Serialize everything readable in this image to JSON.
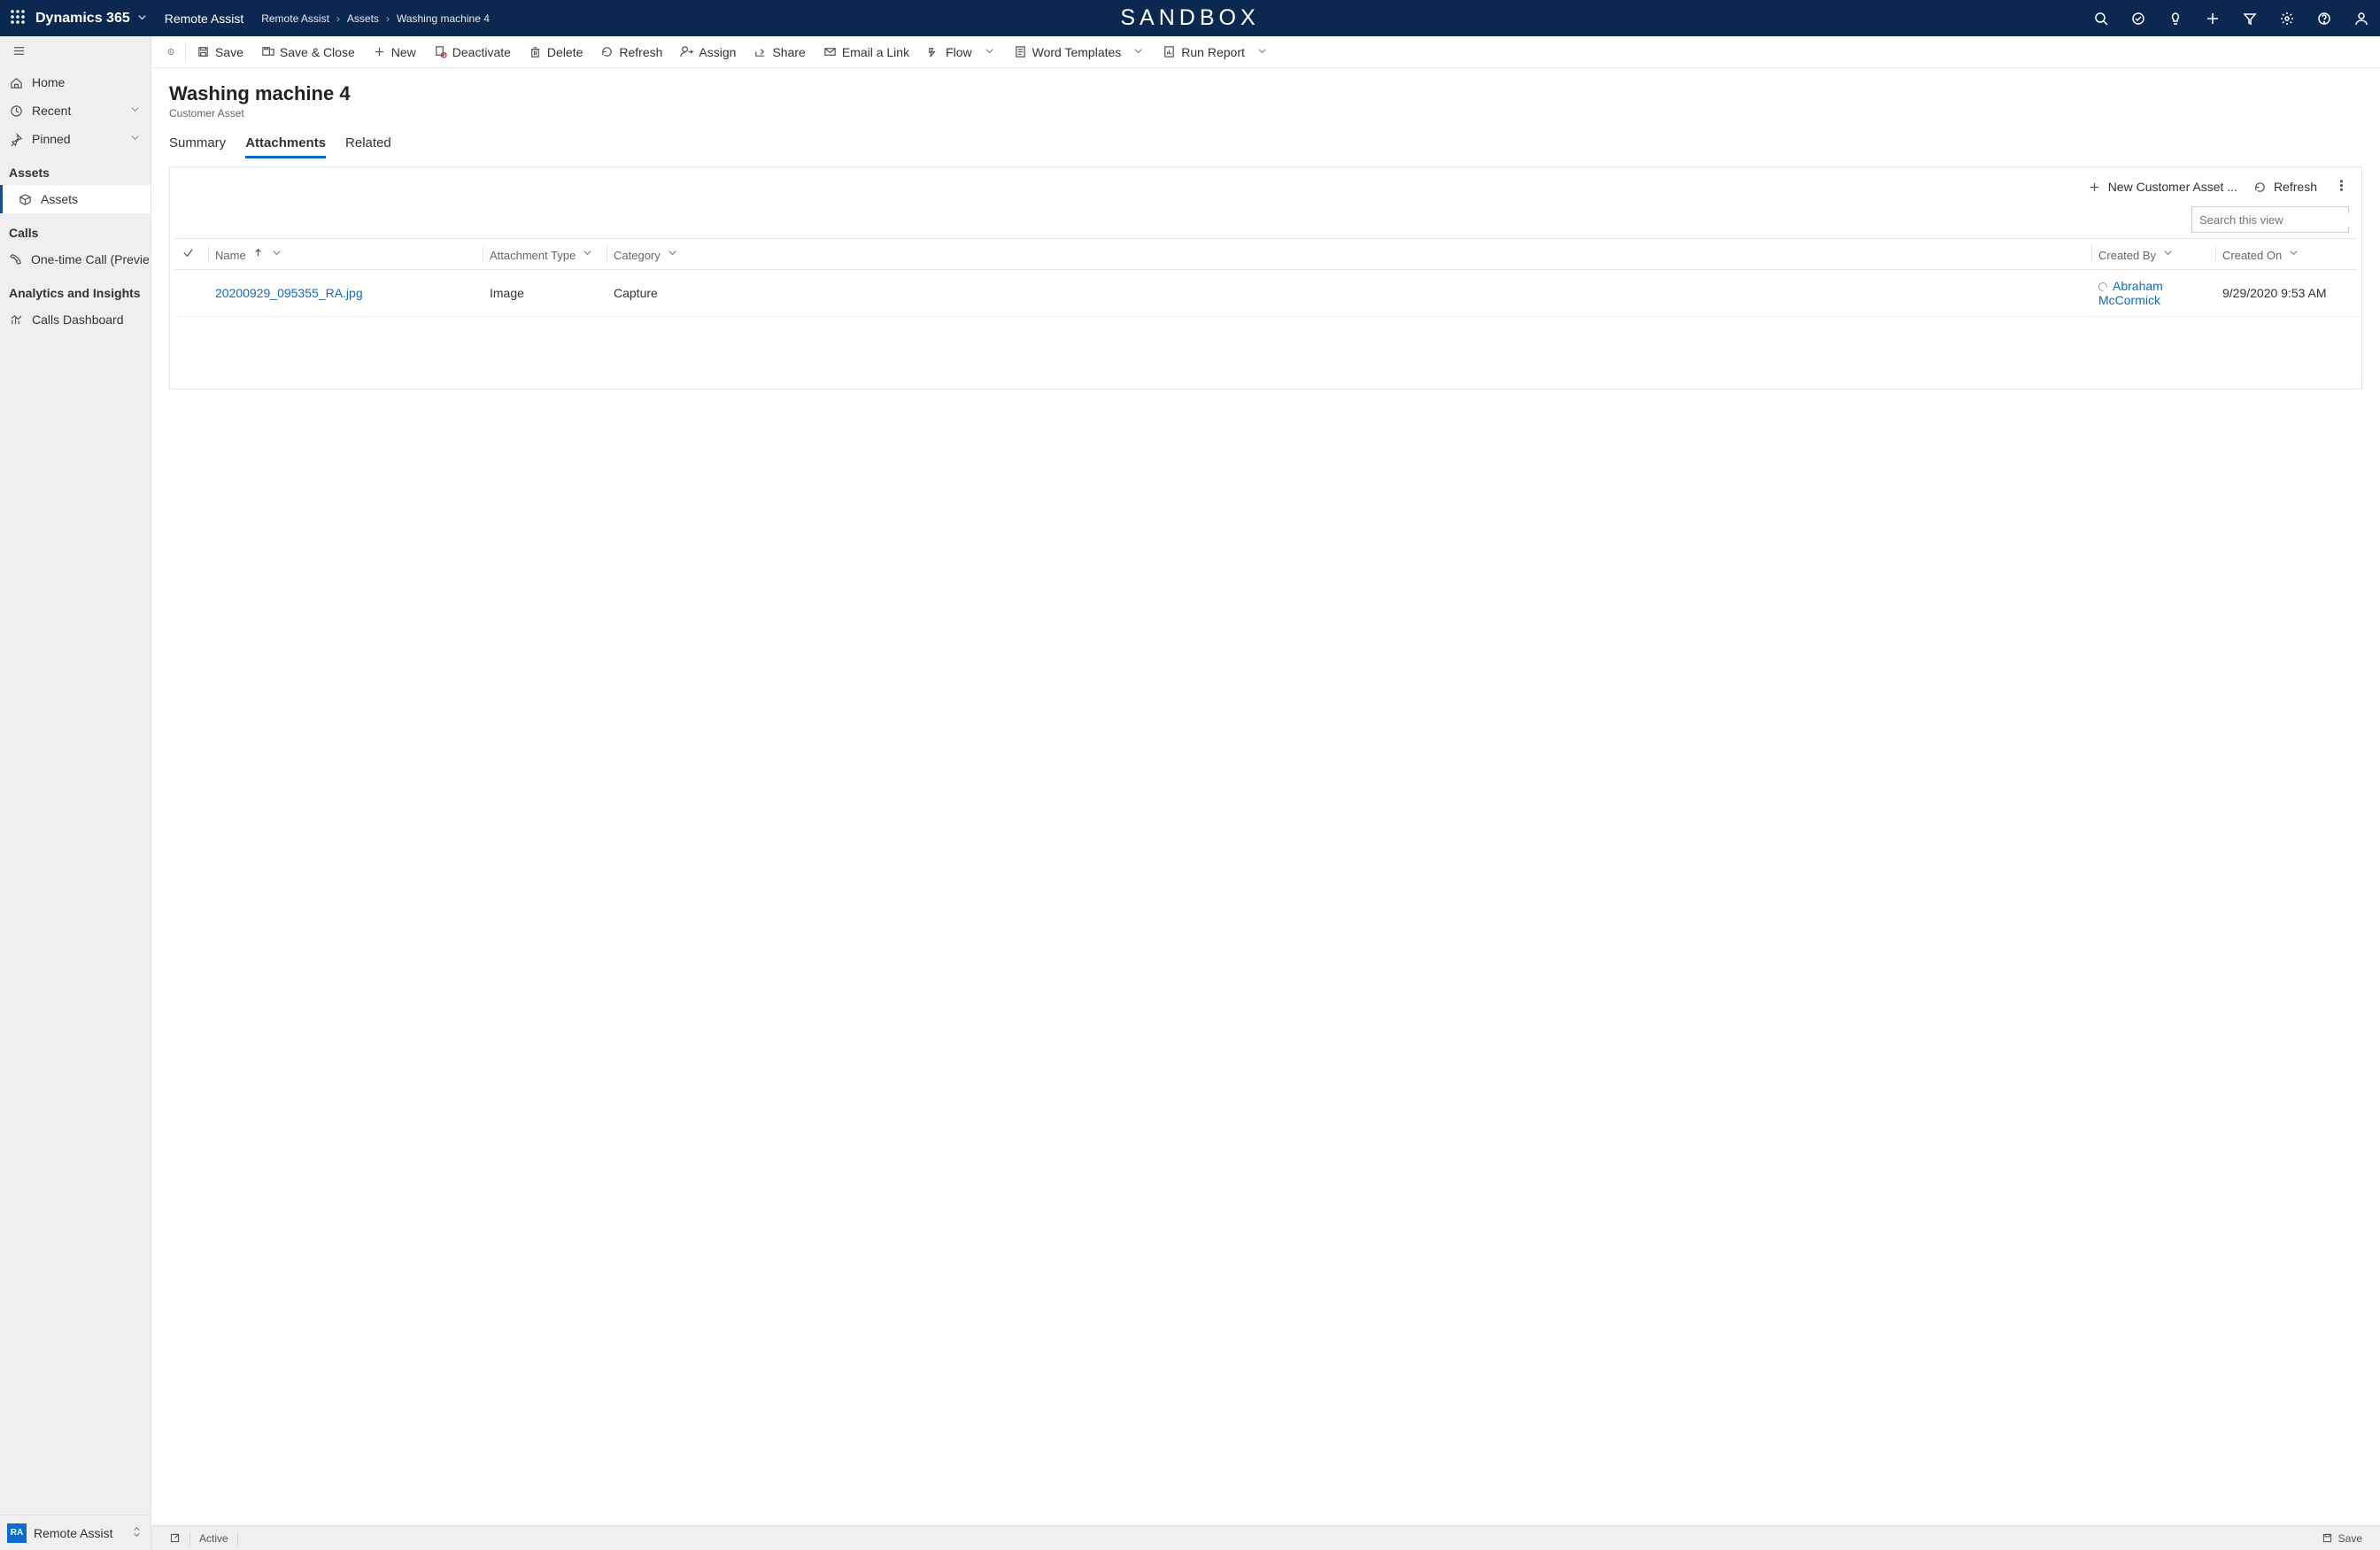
{
  "topbar": {
    "brand": "Dynamics 365",
    "app_name": "Remote Assist",
    "breadcrumb": [
      "Remote Assist",
      "Assets",
      "Washing machine 4"
    ],
    "sandbox": "SANDBOX"
  },
  "sidebar": {
    "items_top": [
      {
        "id": "home",
        "label": "Home",
        "icon": "home"
      },
      {
        "id": "recent",
        "label": "Recent",
        "icon": "clock",
        "expandable": true
      },
      {
        "id": "pinned",
        "label": "Pinned",
        "icon": "pin",
        "expandable": true
      }
    ],
    "sections": [
      {
        "title": "Assets",
        "items": [
          {
            "id": "assets",
            "label": "Assets",
            "icon": "cube",
            "selected": true
          }
        ]
      },
      {
        "title": "Calls",
        "items": [
          {
            "id": "onetime",
            "label": "One-time Call (Previe...",
            "icon": "phone"
          }
        ]
      },
      {
        "title": "Analytics and Insights",
        "items": [
          {
            "id": "dashboard",
            "label": "Calls Dashboard",
            "icon": "chart"
          }
        ]
      }
    ],
    "footer": {
      "badge": "RA",
      "label": "Remote Assist"
    }
  },
  "commands": [
    {
      "id": "back",
      "label": "",
      "icon": "back-circle"
    },
    {
      "id": "sep"
    },
    {
      "id": "save",
      "label": "Save",
      "icon": "save"
    },
    {
      "id": "saveclose",
      "label": "Save & Close",
      "icon": "saveclose"
    },
    {
      "id": "new",
      "label": "New",
      "icon": "plus",
      "accent": "green"
    },
    {
      "id": "deactivate",
      "label": "Deactivate",
      "icon": "deactivate",
      "accent": "red"
    },
    {
      "id": "delete",
      "label": "Delete",
      "icon": "trash"
    },
    {
      "id": "refresh",
      "label": "Refresh",
      "icon": "refresh"
    },
    {
      "id": "assign",
      "label": "Assign",
      "icon": "assign"
    },
    {
      "id": "share",
      "label": "Share",
      "icon": "share"
    },
    {
      "id": "emaillink",
      "label": "Email a Link",
      "icon": "mail"
    },
    {
      "id": "flow",
      "label": "Flow",
      "icon": "flow",
      "dropdown": true
    },
    {
      "id": "word",
      "label": "Word Templates",
      "icon": "word",
      "dropdown": true
    },
    {
      "id": "report",
      "label": "Run Report",
      "icon": "report",
      "dropdown": true
    }
  ],
  "record": {
    "title": "Washing machine  4",
    "subtitle": "Customer Asset"
  },
  "tabs": [
    {
      "id": "summary",
      "label": "Summary"
    },
    {
      "id": "attachments",
      "label": "Attachments",
      "active": true
    },
    {
      "id": "related",
      "label": "Related"
    }
  ],
  "grid": {
    "toolbar": {
      "new_label": "New Customer Asset ...",
      "refresh_label": "Refresh"
    },
    "search_placeholder": "Search this view",
    "columns": [
      {
        "key": "check",
        "label": ""
      },
      {
        "key": "name",
        "label": "Name",
        "sort": "asc",
        "dropdown": true
      },
      {
        "key": "atype",
        "label": "Attachment Type",
        "dropdown": true
      },
      {
        "key": "category",
        "label": "Category",
        "dropdown": true
      },
      {
        "key": "createdby",
        "label": "Created By",
        "dropdown": true
      },
      {
        "key": "createdon",
        "label": "Created On",
        "dropdown": true
      }
    ],
    "rows": [
      {
        "name": "20200929_095355_RA.jpg",
        "atype": "Image",
        "category": "Capture",
        "createdby": "Abraham McCormick",
        "createdon": "9/29/2020 9:53 AM"
      }
    ]
  },
  "statusbar": {
    "active": "Active",
    "save": "Save"
  }
}
